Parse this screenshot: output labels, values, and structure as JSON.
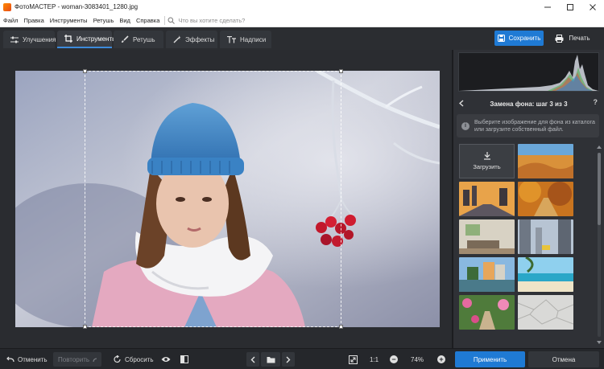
{
  "window": {
    "title": "ФотоМАСТЕР - woman-3083401_1280.jpg",
    "controls": [
      "minimize-icon",
      "maximize-icon",
      "close-icon"
    ]
  },
  "menu": {
    "items": [
      "Файл",
      "Правка",
      "Инструменты",
      "Ретушь",
      "Вид",
      "Справка"
    ],
    "search_placeholder": "Что вы хотите сделать?"
  },
  "tabs": [
    {
      "label": "Улучшения",
      "icon": "sliders-icon"
    },
    {
      "label": "Инструменты",
      "icon": "crop-icon",
      "active": true
    },
    {
      "label": "Ретушь",
      "icon": "brush-icon"
    },
    {
      "label": "Эффекты",
      "icon": "magic-wand-icon"
    },
    {
      "label": "Надписи",
      "icon": "text-icon"
    }
  ],
  "actions": {
    "save_label": "Сохранить",
    "print_label": "Печать"
  },
  "panel": {
    "title": "Замена фона: шаг 3 из 3",
    "help": "?",
    "hint": "Выберите изображение для фона из каталога или загрузите собственный файл.",
    "upload_label": "Загрузить",
    "thumbnails": [
      "desert",
      "city-street-sunset",
      "autumn-park",
      "living-room",
      "city-skyscrapers",
      "canal-houses",
      "tropical-beach",
      "flower-garden",
      "crumpled-paper"
    ]
  },
  "bottom": {
    "undo_label": "Отменить",
    "redo_label": "Повторить",
    "reset_label": "Сбросить",
    "ratio_label": "1:1",
    "zoom_value": "74%",
    "apply_label": "Применить",
    "cancel_label": "Отмена"
  },
  "colors": {
    "accent": "#1f7ad4",
    "background": "#2b2d31",
    "panel": "#2f3136"
  }
}
